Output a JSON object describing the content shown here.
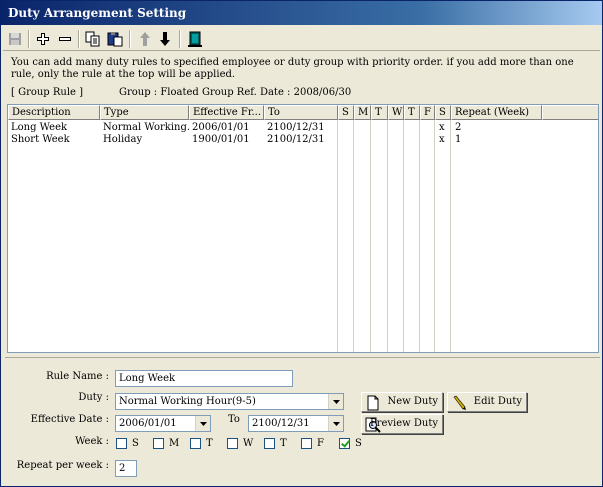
{
  "window": {
    "title": "Duty Arrangement Setting"
  },
  "toolbar": {
    "save_icon": "save-icon",
    "add_icon": "plus-icon",
    "remove_icon": "minus-icon",
    "copy_icon": "copy-icon",
    "paste_icon": "paste-icon",
    "up_icon": "arrow-up-icon",
    "down_icon": "arrow-down-icon",
    "exit_icon": "exit-door-icon"
  },
  "info_text": "You can add many duty rules to specified employee or duty group with priority order. if you add more than one rule, only the rule at the top will be applied.",
  "group_rule_label": "[ Group Rule ]",
  "group_info": "Group : Floated Group  Ref. Date : 2008/06/30",
  "table": {
    "columns": [
      "Description",
      "Type",
      "Effective Fr...",
      "To",
      "S",
      "M",
      "T",
      "W",
      "T",
      "F",
      "S",
      "Repeat (Week)"
    ],
    "rows": [
      [
        "Long Week",
        "Normal Working...",
        "2006/01/01",
        "2100/12/31",
        "",
        "",
        "",
        "",
        "",
        "",
        "x",
        "2"
      ],
      [
        "Short Week",
        "Holiday",
        "1900/01/01",
        "2100/12/31",
        "",
        "",
        "",
        "",
        "",
        "",
        "x",
        "1"
      ]
    ]
  },
  "form": {
    "rule_name_label": "Rule Name :",
    "rule_name_value": "Long Week",
    "duty_label": "Duty :",
    "duty_value": "Normal Working Hour(9-5)",
    "effective_date_label": "Effective Date :",
    "effective_from": "2006/01/01",
    "to_label": "To",
    "effective_to": "2100/12/31",
    "week_label": "Week :",
    "week_days": [
      {
        "label": "S",
        "checked": false
      },
      {
        "label": "M",
        "checked": false
      },
      {
        "label": "T",
        "checked": false
      },
      {
        "label": "W",
        "checked": false
      },
      {
        "label": "T",
        "checked": false
      },
      {
        "label": "F",
        "checked": false
      },
      {
        "label": "S",
        "checked": true
      }
    ],
    "repeat_label": "Repeat per week :",
    "repeat_value": "2",
    "new_duty": "New Duty",
    "edit_duty": "Edit Duty",
    "preview_duty": "Preview Duty"
  }
}
